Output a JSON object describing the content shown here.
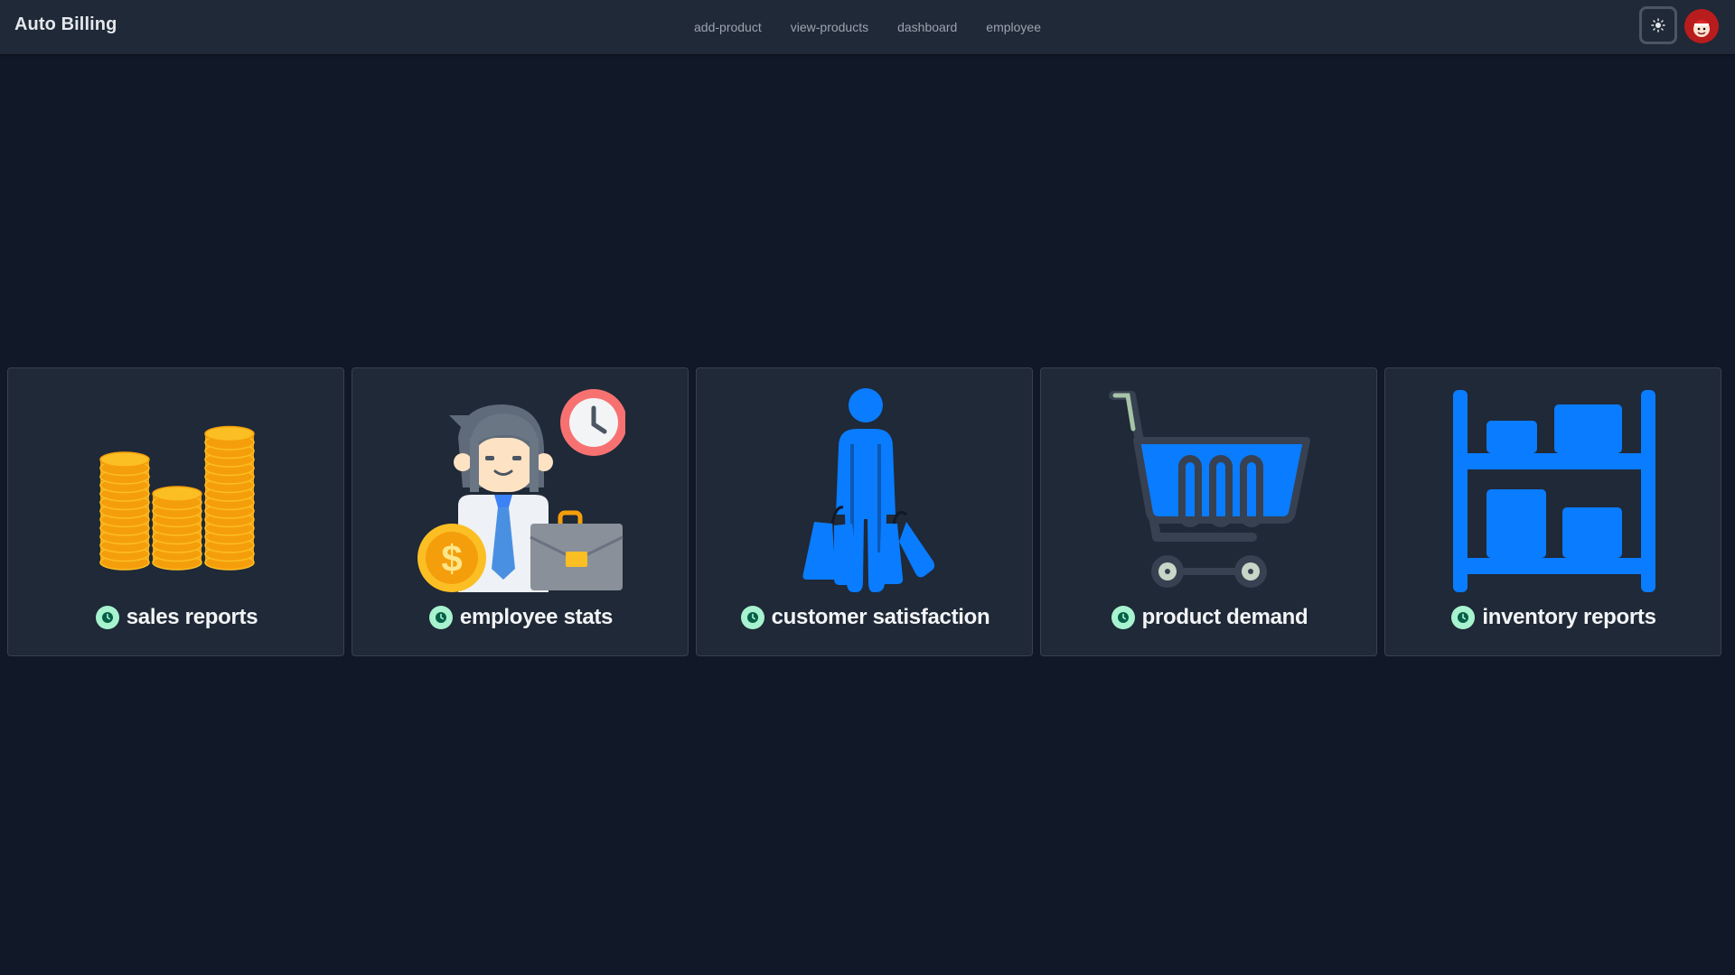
{
  "navbar": {
    "brand": "Auto Billing",
    "links": [
      {
        "label": "add-product"
      },
      {
        "label": "view-products"
      },
      {
        "label": "dashboard"
      },
      {
        "label": "employee"
      }
    ],
    "theme_icon": "sun-icon",
    "avatar_icon": "user-avatar"
  },
  "cards": [
    {
      "label": "sales reports",
      "icon": "coins-stack-icon"
    },
    {
      "label": "employee stats",
      "icon": "employee-icon"
    },
    {
      "label": "customer satisfaction",
      "icon": "shopper-with-bags-icon"
    },
    {
      "label": "product demand",
      "icon": "shopping-cart-icon"
    },
    {
      "label": "inventory reports",
      "icon": "inventory-shelf-icon"
    }
  ],
  "colors": {
    "background": "#111827",
    "navbar": "#1f2937",
    "card": "#1f2937",
    "accent_blue": "#0a7cff",
    "coin_gold": "#fbb80f",
    "badge": "#a7f3d0"
  }
}
